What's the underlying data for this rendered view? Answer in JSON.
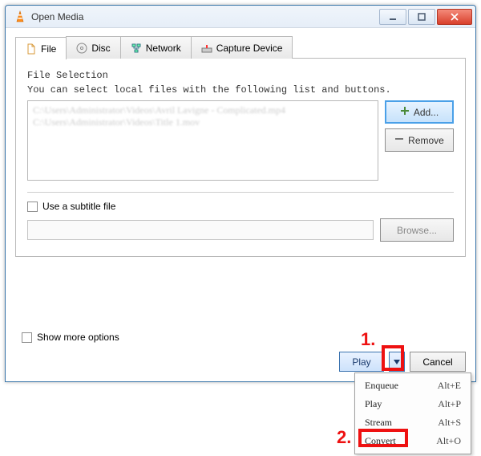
{
  "window": {
    "title": "Open Media"
  },
  "tabs": {
    "file": "File",
    "disc": "Disc",
    "network": "Network",
    "capture": "Capture Device"
  },
  "file_selection": {
    "title": "File Selection",
    "description": "You can select local files with the following list and buttons.",
    "entries": [
      "C:\\Users\\Administrator\\Videos\\Avril Lavigne - Complicated.mp4",
      "C:\\Users\\Administrator\\Videos\\Title 1.mov"
    ],
    "add_label": "Add...",
    "remove_label": "Remove"
  },
  "subtitle": {
    "checkbox_label": "Use a subtitle file",
    "browse_label": "Browse..."
  },
  "footer": {
    "show_more_label": "Show more options",
    "play_label": "Play",
    "cancel_label": "Cancel"
  },
  "dropdown": {
    "items": [
      {
        "label": "Enqueue",
        "shortcut": "Alt+E"
      },
      {
        "label": "Play",
        "shortcut": "Alt+P"
      },
      {
        "label": "Stream",
        "shortcut": "Alt+S"
      },
      {
        "label": "Convert",
        "shortcut": "Alt+O"
      }
    ]
  },
  "annotations": {
    "one": "1.",
    "two": "2."
  }
}
